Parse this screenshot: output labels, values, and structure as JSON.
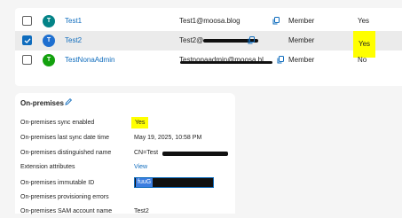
{
  "users": [
    {
      "initial": "T",
      "name": "Test1",
      "upn_visible": "Test1@",
      "upn_tail": "moosa.blog",
      "type": "Member",
      "enabled": "Yes",
      "checked": false,
      "avatar_color": "#038387",
      "highlight": false
    },
    {
      "initial": "T",
      "name": "Test2",
      "upn_visible": "Test2@",
      "upn_tail": "",
      "type": "Member",
      "enabled": "Yes",
      "checked": true,
      "avatar_color": "#1e6fd0",
      "highlight": true
    },
    {
      "initial": "T",
      "name": "TestNonaAdmin",
      "upn_visible": "Testnonaadmin@moosa.bl",
      "upn_tail": "",
      "type": "Member",
      "enabled": "No",
      "checked": false,
      "avatar_color": "#13a10e",
      "highlight": false
    }
  ],
  "onprem": {
    "title": "On-premises",
    "rows": [
      {
        "label": "On-premises sync enabled",
        "value": "Yes"
      },
      {
        "label": "On-premises last sync date time",
        "value": "May 19, 2025, 10:58 PM"
      },
      {
        "label": "On-premises distinguished name",
        "value": "CN=Test"
      },
      {
        "label": "Extension attributes",
        "value": "View"
      },
      {
        "label": "On-premises immutable ID",
        "value": "fuuG"
      },
      {
        "label": "On-premises provisioning errors",
        "value": ""
      },
      {
        "label": "On-premises SAM account name",
        "value": "Test2"
      }
    ]
  },
  "colors": {
    "link": "#0f6cbd",
    "highlight": "#ffff00",
    "selected_row": "#ebebeb"
  }
}
